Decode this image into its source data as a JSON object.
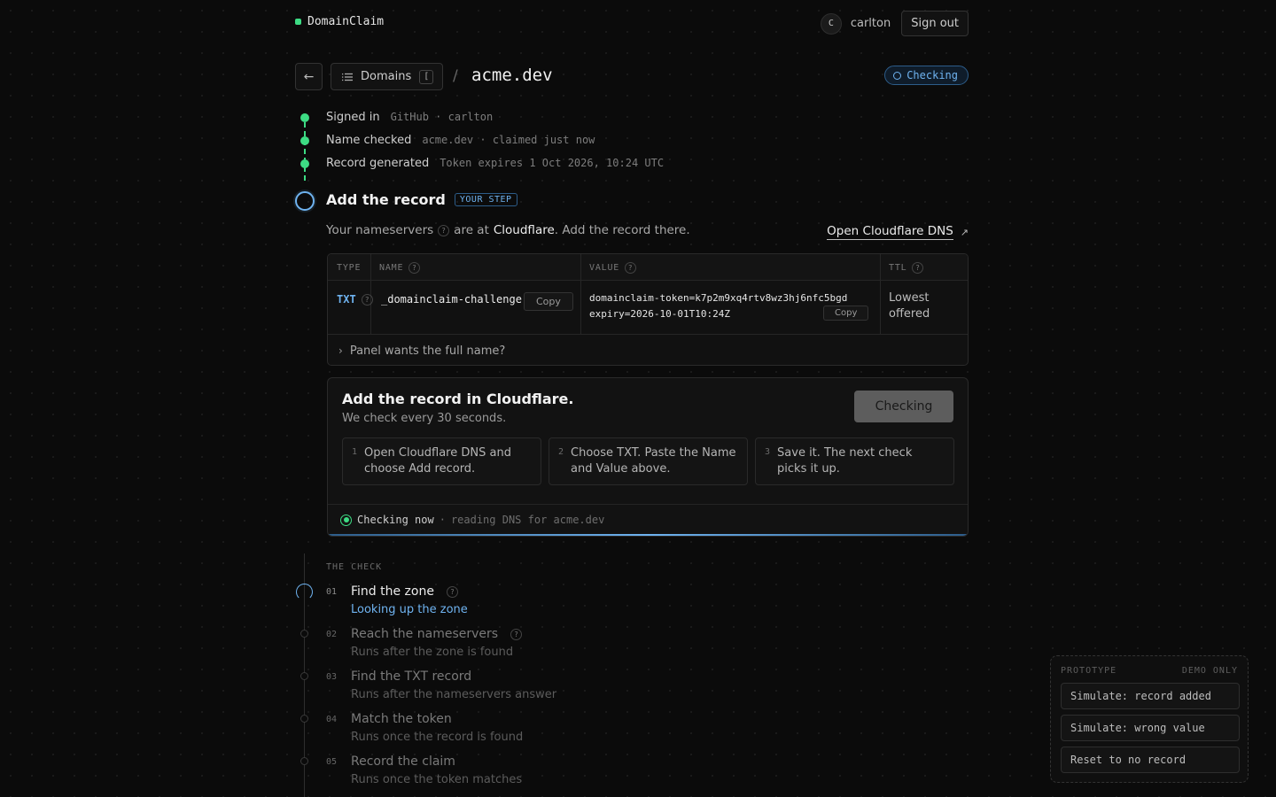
{
  "header": {
    "brand": "DomainClaim",
    "avatar_initial": "C",
    "username": "carlton",
    "sign_out": "Sign out"
  },
  "breadcrumb": {
    "back_icon": "arrow-left-icon",
    "domains_label": "Domains",
    "domains_shortcut": "[",
    "separator": "/",
    "title": "acme.dev",
    "status": "Checking"
  },
  "completed_steps": [
    {
      "label": "Signed in",
      "meta": "GitHub · carlton"
    },
    {
      "label": "Name checked",
      "meta": "acme.dev · claimed just now"
    },
    {
      "label": "Record generated",
      "meta": "Token expires 1 Oct 2026, 10:24 UTC"
    }
  ],
  "current_step": {
    "title": "Add the record",
    "badge": "YOUR STEP",
    "ns_prefix": "Your nameservers",
    "ns_mid": "are at",
    "ns_provider": "Cloudflare",
    "ns_suffix": ". Add the record there.",
    "dns_link": "Open Cloudflare DNS"
  },
  "record_table": {
    "headers": {
      "type": "TYPE",
      "name": "NAME",
      "value": "VALUE",
      "ttl": "TTL"
    },
    "row": {
      "type": "TXT",
      "name": "_domainclaim-challenge",
      "value_line1": "domainclaim-token=k7p2m9xq4rtv8wz3hj6nfc5bgd",
      "value_line2": "expiry=2026-10-01T10:24Z",
      "ttl_line1": "Lowest",
      "ttl_line2": "offered"
    },
    "copy_label": "Copy",
    "expander": "Panel wants the full name?"
  },
  "action_card": {
    "title": "Add the record in Cloudflare.",
    "subtitle": "We check every 30 seconds.",
    "button": "Checking",
    "steps": [
      {
        "num": "1",
        "text": "Open Cloudflare DNS and choose Add record."
      },
      {
        "num": "2",
        "text": "Choose TXT. Paste the Name and Value above."
      },
      {
        "num": "3",
        "text": "Save it. The next check picks it up."
      }
    ],
    "status_now": "Checking now",
    "status_sep": "·",
    "status_detail": "reading DNS for acme.dev"
  },
  "the_check": {
    "label": "THE CHECK",
    "items": [
      {
        "num": "01",
        "name": "Find the zone",
        "sub": "Looking up the zone"
      },
      {
        "num": "02",
        "name": "Reach the nameservers",
        "sub": "Runs after the zone is found"
      },
      {
        "num": "03",
        "name": "Find the TXT record",
        "sub": "Runs after the nameservers answer"
      },
      {
        "num": "04",
        "name": "Match the token",
        "sub": "Runs once the record is found"
      },
      {
        "num": "05",
        "name": "Record the claim",
        "sub": "Runs once the token matches"
      }
    ]
  },
  "prototype": {
    "label": "PROTOTYPE",
    "tag": "DEMO ONLY",
    "buttons": [
      "Simulate: record added",
      "Simulate: wrong value",
      "Reset to no record"
    ]
  },
  "colors": {
    "accent_green": "#3ddc84",
    "accent_blue": "#6fb3f0",
    "background": "#0b0b0b"
  }
}
